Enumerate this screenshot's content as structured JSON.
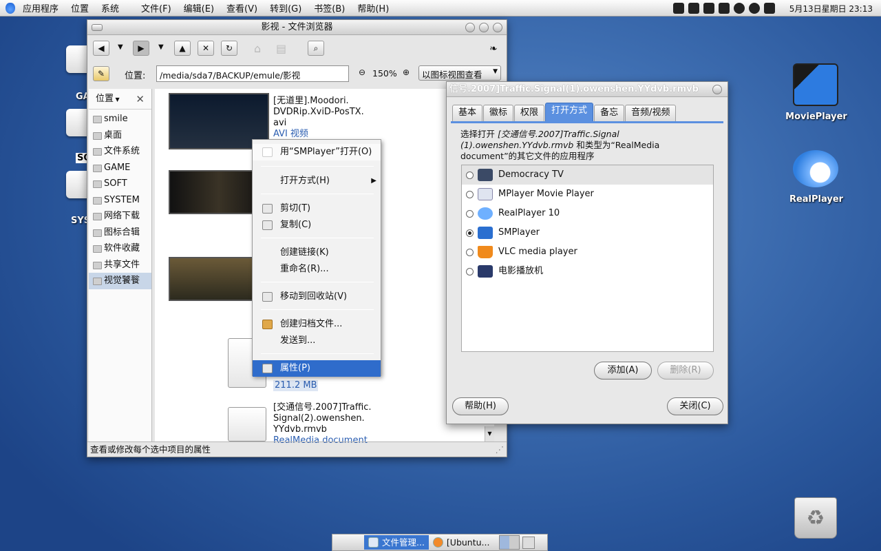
{
  "topbar": {
    "menus": [
      "应用程序",
      "位置",
      "系统"
    ],
    "app_menus": [
      "文件(F)",
      "编辑(E)",
      "查看(V)",
      "转到(G)",
      "书签(B)",
      "帮助(H)"
    ],
    "clock": "5月13日星期日 23:13"
  },
  "desktop": {
    "left_labels": [
      "GA",
      "SO",
      "SYS"
    ],
    "icons": [
      {
        "label": "MoviePlayer"
      },
      {
        "label": "RealPlayer"
      }
    ]
  },
  "window": {
    "title": "影视 - 文件浏览器",
    "location_label": "位置:",
    "path": "/media/sda7/BACKUP/emule/影视",
    "zoom": "150%",
    "view_mode": "以图标视图查看",
    "sidebar": {
      "header": "位置",
      "items": [
        "smile",
        "桌面",
        "文件系统",
        "GAME",
        "SOFT",
        "SYSTEM",
        "网络下载",
        "图标合辑",
        "软件收藏",
        "共享文件",
        "视觉饕餮"
      ]
    },
    "files": [
      {
        "name": [
          "[无道里].Moodori.",
          "DVDRip.XviD-PosTX.",
          "avi"
        ],
        "type": "AVI 视频"
      },
      {
        "name": [
          "",
          "",
          ""
        ],
        "type": ""
      },
      {
        "name": [
          "",
          "",
          ""
        ],
        "type": ""
      },
      {
        "name": [
          "",
          "",
          ""
        ],
        "type": "211.2 MB"
      },
      {
        "name": [
          "[交通信号.2007]Traffic.",
          "Signal(2).owenshen.",
          "YYdvb.rmvb"
        ],
        "type": "RealMedia document"
      }
    ],
    "status": "查看或修改每个选中项目的属性"
  },
  "context_menu": {
    "items": [
      "用“SMPlayer”打开(O)",
      "打开方式(H)",
      "剪切(T)",
      "复制(C)",
      "创建链接(K)",
      "重命名(R)...",
      "移动到回收站(V)",
      "创建归档文件...",
      "发送到...",
      "属性(P)"
    ]
  },
  "dialog": {
    "title": "信号.2007]Traffic.Signal(1).owenshen.YYdvb.rmvb",
    "tabs": [
      "基本",
      "徽标",
      "权限",
      "打开方式",
      "备忘",
      "音频/视频"
    ],
    "desc_prefix": "选择打开 ",
    "desc_file": "[交通信号.2007]Traffic.Signal (1).owenshen.YYdvb.rmvb",
    "desc_suffix": " 和类型为“RealMedia document”的其它文件的应用程序",
    "apps": [
      "Democracy TV",
      "MPlayer Movie Player",
      "RealPlayer 10",
      "SMPlayer",
      "VLC media player",
      "电影播放机"
    ],
    "selected_app": "SMPlayer",
    "add": "添加(A)",
    "remove": "删除(R)",
    "help": "帮助(H)",
    "close": "关闭(C)"
  },
  "taskbar": {
    "items": [
      "文件管理...",
      "[Ubuntu..."
    ]
  },
  "colors": {
    "accent": "#5b90e0",
    "selection": "#2f6ccb"
  }
}
